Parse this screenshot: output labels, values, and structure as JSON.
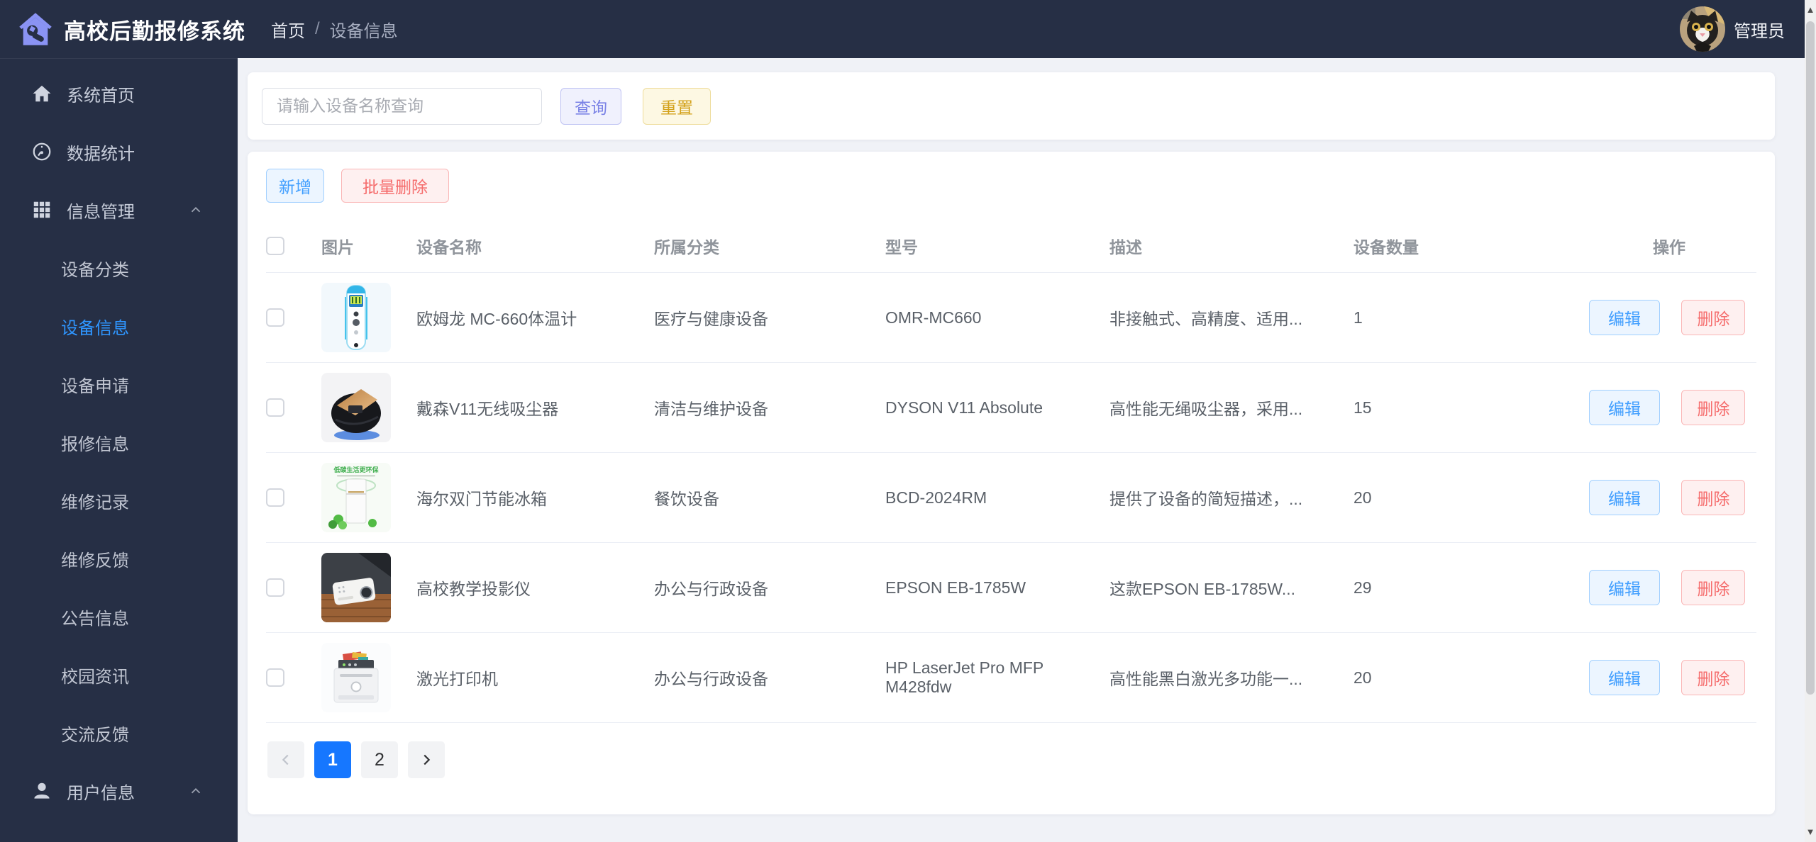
{
  "app": {
    "title": "高校后勤报修系统",
    "logo_icon": "house-wrench-icon"
  },
  "breadcrumb": {
    "items": [
      "首页",
      "设备信息"
    ],
    "separator": "/"
  },
  "user": {
    "name": "管理员",
    "avatar": "cat-photo"
  },
  "sidebar": {
    "items": [
      {
        "label": "系统首页",
        "icon": "home-icon"
      },
      {
        "label": "数据统计",
        "icon": "gauge-icon"
      },
      {
        "label": "信息管理",
        "icon": "grid-icon",
        "expanded": true
      },
      {
        "label": "用户信息",
        "icon": "user-icon",
        "expanded": true
      }
    ],
    "submenu": {
      "parent": "信息管理",
      "children": [
        "设备分类",
        "设备信息",
        "设备申请",
        "报修信息",
        "维修记录",
        "维修反馈",
        "公告信息",
        "校园资讯",
        "交流反馈"
      ],
      "active": "设备信息"
    }
  },
  "search": {
    "placeholder": "请输入设备名称查询",
    "value": "",
    "query_label": "查询",
    "reset_label": "重置"
  },
  "toolbar": {
    "add_label": "新增",
    "batch_delete_label": "批量删除"
  },
  "table": {
    "headers": [
      "图片",
      "设备名称",
      "所属分类",
      "型号",
      "描述",
      "设备数量",
      "操作"
    ],
    "edit_label": "编辑",
    "delete_label": "删除",
    "rows": [
      {
        "image": "thermometer-photo",
        "name": "欧姆龙 MC-660体温计",
        "category": "医疗与健康设备",
        "model": "OMR-MC660",
        "description": "非接触式、高精度、适用...",
        "quantity": "1"
      },
      {
        "image": "vacuum-photo",
        "name": "戴森V11无线吸尘器",
        "category": "清洁与维护设备",
        "model": "DYSON V11 Absolute",
        "description": "高性能无绳吸尘器，采用...",
        "quantity": "15"
      },
      {
        "image": "fridge-photo",
        "image_text": "低碳生活更环保",
        "name": "海尔双门节能冰箱",
        "category": "餐饮设备",
        "model": "BCD-2024RM",
        "description": "提供了设备的简短描述，...",
        "quantity": "20"
      },
      {
        "image": "projector-photo",
        "name": "高校教学投影仪",
        "category": "办公与行政设备",
        "model": "EPSON EB-1785W",
        "description": "这款EPSON EB-1785W...",
        "quantity": "29"
      },
      {
        "image": "printer-photo",
        "name": "激光打印机",
        "category": "办公与行政设备",
        "model": "HP LaserJet Pro MFP M428fdw",
        "description": "高性能黑白激光多功能一...",
        "quantity": "20"
      }
    ]
  },
  "pagination": {
    "pages": [
      "1",
      "2"
    ],
    "active_page": "1"
  },
  "colors": {
    "header_bg": "#262f45",
    "sidebar_bg": "#262f45",
    "logo_purple": "#8a93f4",
    "active_menu": "#2f96ff",
    "primary_blue": "#409eff",
    "danger_red": "#f56c6c",
    "query_purple": "#7a82e6",
    "reset_gold": "#d3a11a",
    "active_page_blue": "#1677ff",
    "content_bg": "#f0f2f7"
  }
}
